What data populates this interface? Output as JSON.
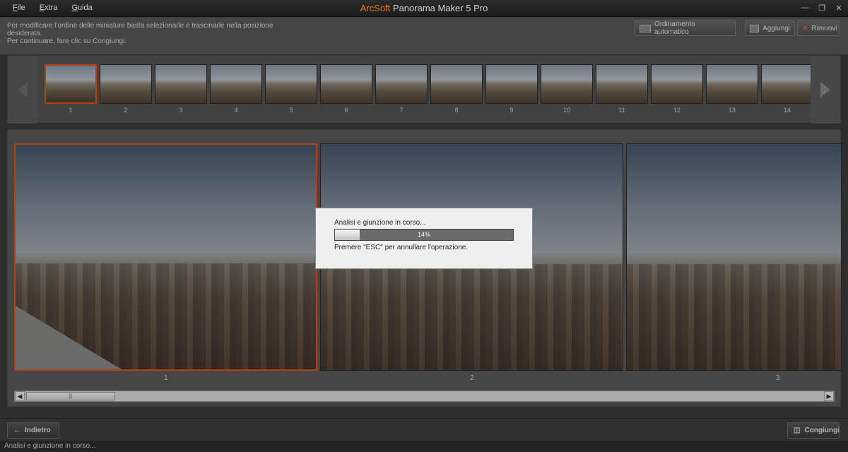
{
  "window": {
    "brand": "ArcSoft",
    "product": " Panorama Maker 5 Pro"
  },
  "menu": [
    "File",
    "Extra",
    "Guida"
  ],
  "window_controls": [
    "minimize",
    "restore",
    "close"
  ],
  "instructions": {
    "line1": "Per modificare l'ordine delle miniature basta selezionarle e trascinarle nella posizione desiderata.",
    "line2": "Per continuare, fare clic su Congiungi."
  },
  "toolbar": {
    "sort_label": "Ordinamento automatico",
    "add_label": "Aggiungi",
    "remove_label": "Rimuovi"
  },
  "thumbnails": [
    "1",
    "2",
    "3",
    "4",
    "5",
    "6",
    "7",
    "8",
    "9",
    "10",
    "11",
    "12",
    "13",
    "14"
  ],
  "frames": [
    "1",
    "2",
    "3"
  ],
  "dialog": {
    "title": "Analisi e giunzione in corso...",
    "progress_value": 0.14,
    "progress_label": "14%",
    "hint": "Premere \"ESC\" per annullare l'operazione."
  },
  "bottom": {
    "back_label": "Indietro",
    "join_label": "Congiungi"
  },
  "status": "Analisi e giunzione in corso...",
  "colors": {
    "accent": "#e3541f",
    "brand": "#e87a2c"
  }
}
